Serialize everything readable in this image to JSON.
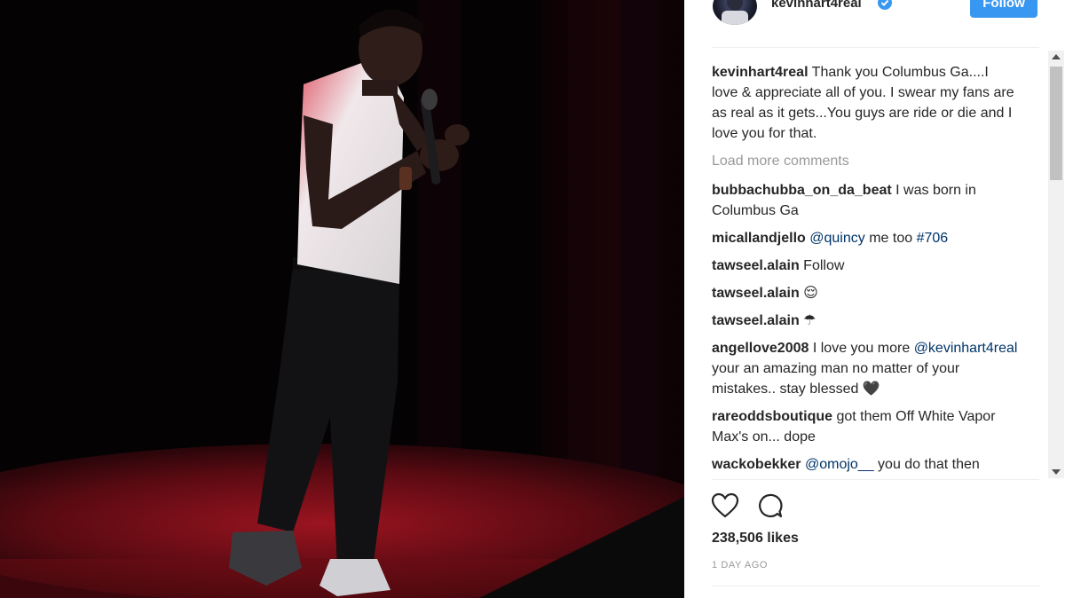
{
  "header": {
    "username": "kevinhart4real",
    "follow_label": "Follow"
  },
  "caption": {
    "user": "kevinhart4real",
    "text": "Thank you Columbus Ga....I love & appreciate all of you. I swear my fans are as real as it gets...You guys are ride or die and I love you for that."
  },
  "load_more": "Load more comments",
  "comments": [
    {
      "user": "bubbachubba_on_da_beat",
      "text": "I was born in Columbus Ga"
    },
    {
      "user": "micallandjello",
      "mention": "@quincy",
      "text": " me too ",
      "tag": "#706"
    },
    {
      "user": "tawseel.alain",
      "text": "Follow"
    },
    {
      "user": "tawseel.alain",
      "text": "😌"
    },
    {
      "user": "tawseel.alain",
      "text": "☂"
    },
    {
      "user": "angellove2008",
      "text": "I love you more ",
      "mention": "@kevinhart4real",
      "text2": " your an amazing man no matter of your mistakes.. stay blessed 🖤"
    },
    {
      "user": "rareoddsboutique",
      "text": "got them Off White Vapor Max's on... dope"
    },
    {
      "user": "wackobekker",
      "mention": "@omojo__",
      "text": " you do that then"
    }
  ],
  "likes": "238,506 likes",
  "date": "1 DAY AGO",
  "icons": {
    "verified": "verified-badge-icon",
    "like": "heart-icon",
    "comment": "speech-bubble-icon"
  },
  "colors": {
    "follow_button": "#3897f0",
    "mention": "#003569",
    "muted": "#999999",
    "stage_red": "#8b0d16"
  }
}
